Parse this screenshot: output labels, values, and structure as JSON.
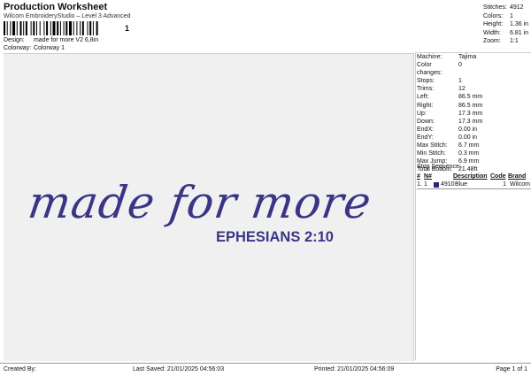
{
  "header": {
    "title": "Production Worksheet",
    "subtitle": "Wilcom EmbroideryStudio – Level 3 Advanced",
    "barcode_suffix": "1"
  },
  "meta": {
    "design_label": "Design:",
    "design_value": "made for more V2 6,8in",
    "colorway_label": "Colorway:",
    "colorway_value": "Colorway 1"
  },
  "top_stats": [
    {
      "label": "Stitches:",
      "value": "4912"
    },
    {
      "label": "Colors:",
      "value": "1"
    },
    {
      "label": "Height:",
      "value": "1.36 in"
    },
    {
      "label": "Width:",
      "value": "6.81 in"
    },
    {
      "label": "Zoom:",
      "value": "1:1"
    }
  ],
  "properties": [
    {
      "label": "Machine:",
      "value": "Tajima"
    },
    {
      "label": "Color changes:",
      "value": "0"
    },
    {
      "label": "Stops:",
      "value": "1"
    },
    {
      "label": "Trims:",
      "value": "12"
    },
    {
      "label": "Left:",
      "value": "86.5 mm"
    },
    {
      "label": "Right:",
      "value": "86.5 mm"
    },
    {
      "label": "Up:",
      "value": "17.3 mm"
    },
    {
      "label": "Down:",
      "value": "17.3 mm"
    },
    {
      "label": "EndX:",
      "value": "0.00 in"
    },
    {
      "label": "EndY:",
      "value": "0.00 in"
    },
    {
      "label": "Max Stitch:",
      "value": "6.7 mm"
    },
    {
      "label": "Min Stitch:",
      "value": "0.3 mm"
    },
    {
      "label": "Max Jump:",
      "value": "6.9 mm"
    },
    {
      "label": "Total Bobbin:",
      "value": "21.48ft"
    }
  ],
  "stop_sequence": {
    "heading": "Stop Sequence:",
    "columns": [
      "#",
      "N#",
      "Description",
      "Code",
      "Brand"
    ],
    "rows": [
      {
        "num": "1.",
        "n": "1",
        "code_id": "4910",
        "description": "Blue",
        "code": "1",
        "brand": "Wilcom",
        "color": "#2b2a7a"
      }
    ]
  },
  "design": {
    "script_text": "made for more",
    "caps_text": "EPHESIANS 2:10",
    "thread_color": "#3a3585"
  },
  "footer": {
    "created_by": "Created By:",
    "last_saved": "Last Saved: 21/01/2025 04:56:03",
    "printed": "Printed: 21/01/2025 04:56:09",
    "page": "Page 1 of 1"
  }
}
